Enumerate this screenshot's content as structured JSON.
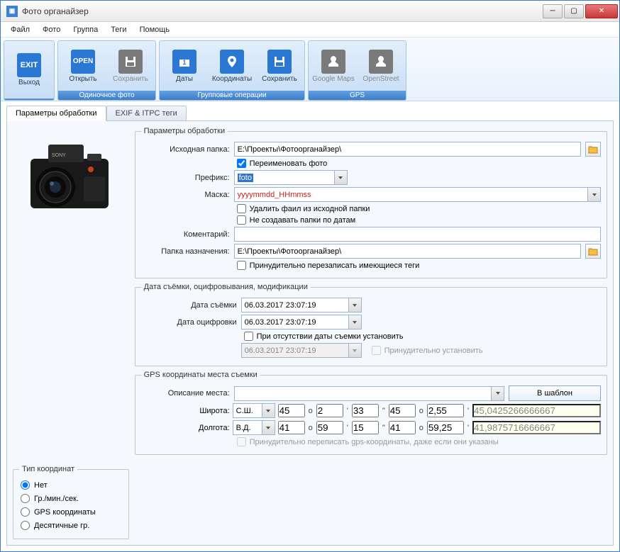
{
  "window": {
    "title": "Фото органайзер"
  },
  "menu": {
    "file": "Файл",
    "photo": "Фото",
    "group": "Группа",
    "tags": "Теги",
    "help": "Помощь"
  },
  "ribbon": {
    "exit": "Выход",
    "open": "Открыть",
    "save": "Сохранить",
    "dates": "Даты",
    "coords": "Координаты",
    "save2": "Сохранить",
    "gmaps": "Google Maps",
    "osm": "OpenStreet",
    "g1": "",
    "g2": "Одиночное фото",
    "g3": "Групповые операции",
    "g4": "GPS"
  },
  "tabs": {
    "params": "Параметры обработки",
    "exif": "EXIF & ITPC теги"
  },
  "params": {
    "legend": "Параметры обработки",
    "src_folder_label": "Исходная папка:",
    "src_folder": "E:\\Проекты\\Фотоорганайзер\\",
    "rename": "Переименовать фото",
    "prefix_label": "Префикс:",
    "prefix": "foto",
    "mask_label": "Маска:",
    "mask": "yyyymmdd_HHmmss",
    "delete_src": "Удалить фаил из исходной папки",
    "no_date_folders": "Не создавать папки по датам",
    "comment_label": "Коментарий:",
    "comment": "",
    "dst_folder_label": "Папка назначения:",
    "dst_folder": "E:\\Проекты\\Фотоорганайзер\\",
    "force_overwrite": "Принудительно перезаписать имеющиеся теги"
  },
  "dates": {
    "legend": "Дата съёмки, оцифровывания, модификации",
    "shot_label": "Дата съёмки",
    "shot": "06.03.2017 23:07:19",
    "digi_label": "Дата оцифровки",
    "digi": "06.03.2017 23:07:19",
    "if_absent": "При отсутствии даты съемки установить",
    "default_date": "06.03.2017 23:07:19",
    "force_set": "Принудительно установить"
  },
  "coord_type": {
    "legend": "Тип координат",
    "none": "Нет",
    "dms": "Гр./мин./сек.",
    "gps": "GPS координаты",
    "dec": "Десятичные гр."
  },
  "gps": {
    "legend": "GPS координаты места съемки",
    "place_label": "Описание места:",
    "place": "",
    "template_btn": "В шаблон",
    "lat_label": "Широта:",
    "lat_nsew": "С.Ш.",
    "lat_d": "45",
    "lat_m": "2",
    "lat_s": "33",
    "lat_s2": "45",
    "lat_s3": "2,55",
    "lat_dec": "45,0425266666667",
    "lon_label": "Долгота:",
    "lon_nsew": "В.Д.",
    "lon_d": "41",
    "lon_m": "59",
    "lon_s": "15",
    "lon_s2": "41",
    "lon_s3": "59,25",
    "lon_dec": "41,9875716666667",
    "force_gps": "Принудительно переписать gps-координаты, даже если они указаны"
  }
}
